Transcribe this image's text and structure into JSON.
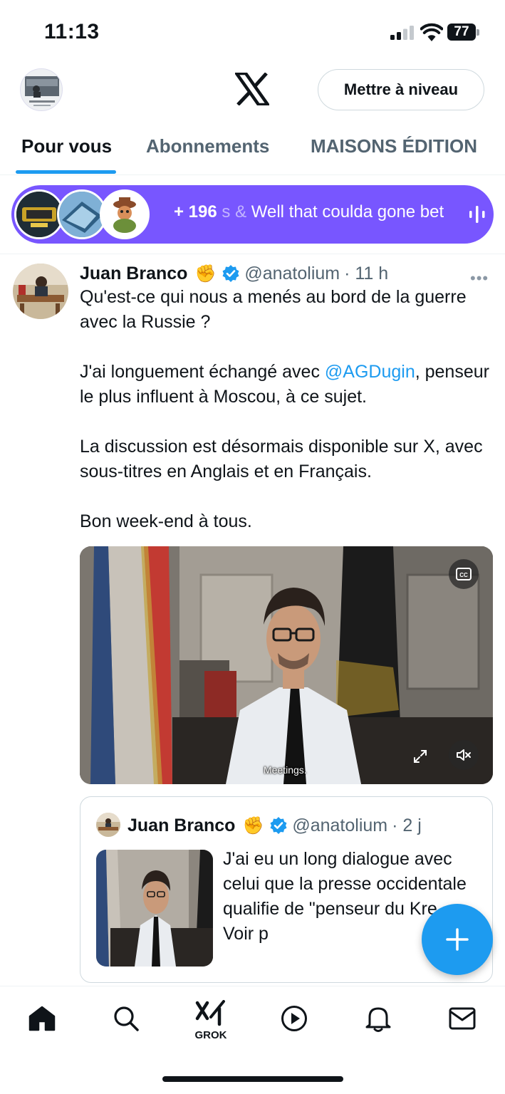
{
  "status_bar": {
    "time": "11:13",
    "battery": "77"
  },
  "header": {
    "upgrade_label": "Mettre à niveau"
  },
  "tabs": [
    {
      "label": "Pour vous"
    },
    {
      "label": "Abonnements"
    },
    {
      "label": "MAISONS ÉDITION"
    }
  ],
  "spaces": {
    "count": "+ 196",
    "fade_text": "s &",
    "topic": " Well that coulda gone bet"
  },
  "tweet": {
    "author": "Juan Branco",
    "emoji": "✊",
    "handle": "@anatolium",
    "time": "· 11 h",
    "line1": "Qu'est-ce qui nous a menés au bord de la guerre avec la Russie ?",
    "line2_pre": "J'ai longuement échangé avec ",
    "line2_mention": "@AGDugin",
    "line2_post": ", penseur le plus influent à Moscou, à ce sujet.",
    "line3": "La discussion est désormais disponible sur X, avec sous-titres en Anglais et en Français.",
    "line4": "Bon week-end à tous.",
    "video_caption": "Meetings.",
    "video_cc": "CC"
  },
  "quote": {
    "author": "Juan Branco",
    "emoji": "✊",
    "handle": "@anatolium",
    "time": "· 2 j",
    "text": "J'ai eu un long dialogue avec celui que la presse occidentale qualifie de \"penseur du Kre... Voir p"
  },
  "nav": {
    "grok_label": "GROK"
  },
  "colors": {
    "accent": "#1d9bf0",
    "spaces": "#7856ff",
    "text": "#0f1419",
    "muted": "#536471"
  }
}
